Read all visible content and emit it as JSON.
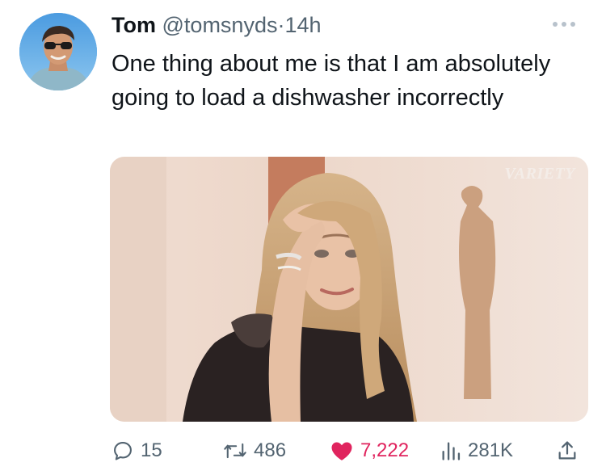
{
  "author": {
    "name": "Tom",
    "handle": "@tomsnyds",
    "separator": "·",
    "time": "14h"
  },
  "tweet": {
    "text": "One thing about me is that I am absolutely going to load a dishwasher incorrectly"
  },
  "media": {
    "watermark": "VARIETY"
  },
  "actions": {
    "replies": "15",
    "retweets": "486",
    "likes": "7,222",
    "views": "281K"
  },
  "colors": {
    "like": "#e0245e",
    "muted": "#536471",
    "text": "#0f1419"
  },
  "icons": [
    "more-icon",
    "reply-icon",
    "retweet-icon",
    "like-icon",
    "views-icon",
    "share-icon"
  ]
}
